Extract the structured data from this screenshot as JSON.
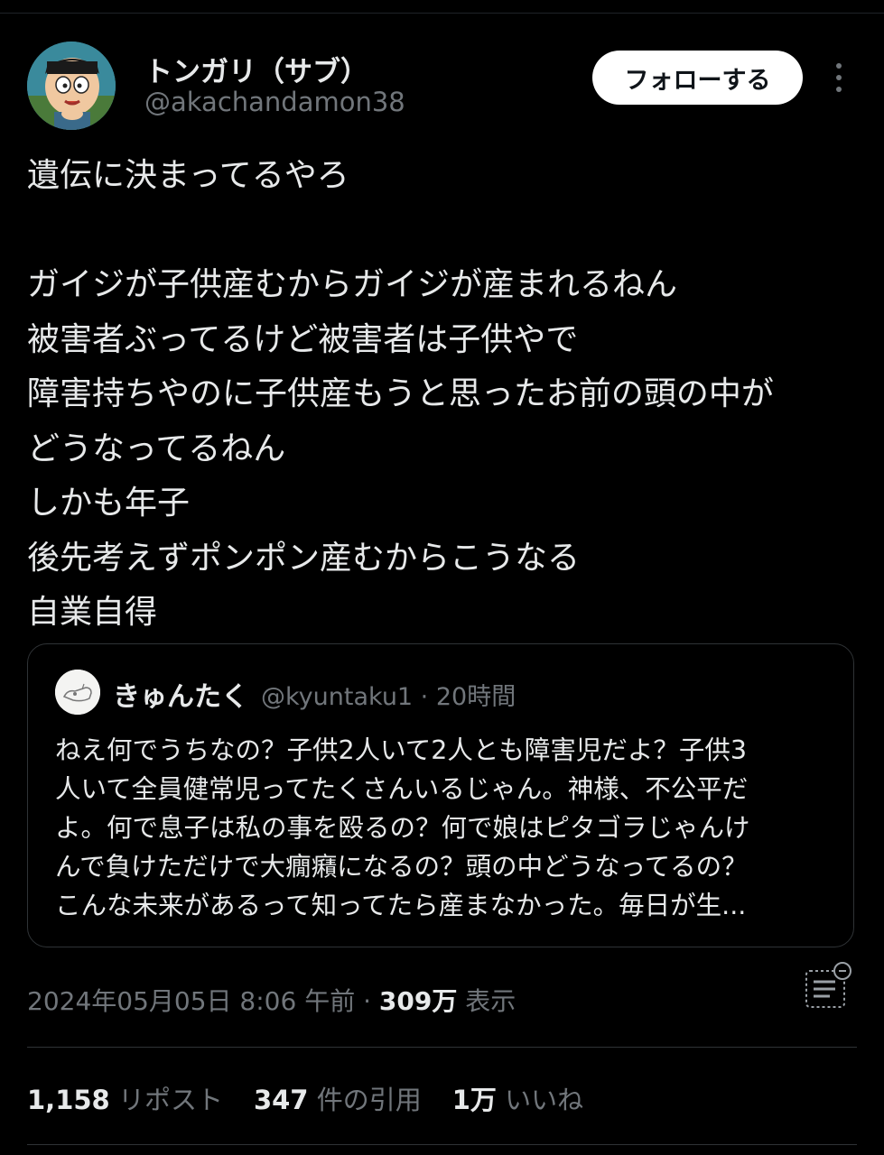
{
  "author": {
    "display_name": "トンガリ（サブ）",
    "handle": "@akachandamon38"
  },
  "follow_button": "フォローする",
  "more_icon": "more-vertical-icon",
  "tweet_lines": [
    "遺伝に決まってるやろ",
    "",
    "ガイジが子供産むからガイジが産まれるねん",
    "被害者ぶってるけど被害者は子供やで",
    "障害持ちやのに子供産もうと思ったお前の頭の中が",
    "どうなってるねん",
    "しかも年子",
    "後先考えずポンポン産むからこうなる",
    "自業自得"
  ],
  "quote": {
    "display_name": "きゅんたく",
    "meta": "@kyuntaku1 · 20時間",
    "lines": [
      "ねえ何でうちなの？子供2人いて2人とも障害児だよ？子供3",
      "人いて全員健常児ってたくさんいるじゃん。神様、不公平だ",
      "よ。何で息子は私の事を殴るの？何で娘はピタゴラじゃんけ",
      "んで負けただけで大癇癪になるの？頭の中どうなってるの？",
      "こんな未来があるって知ってたら産まなかった。毎日が生..."
    ]
  },
  "timestamp": "2024年05月05日 8:06 午前",
  "separator": " · ",
  "views": {
    "count": "309万",
    "label": " 表示"
  },
  "analytics_icon": "analytics-icon",
  "stats": {
    "reposts": {
      "count": "1,158",
      "label": " リポスト"
    },
    "quotes": {
      "count": "347",
      "label": " 件の引用"
    },
    "likes": {
      "count": "1万",
      "label": " いいね"
    }
  }
}
